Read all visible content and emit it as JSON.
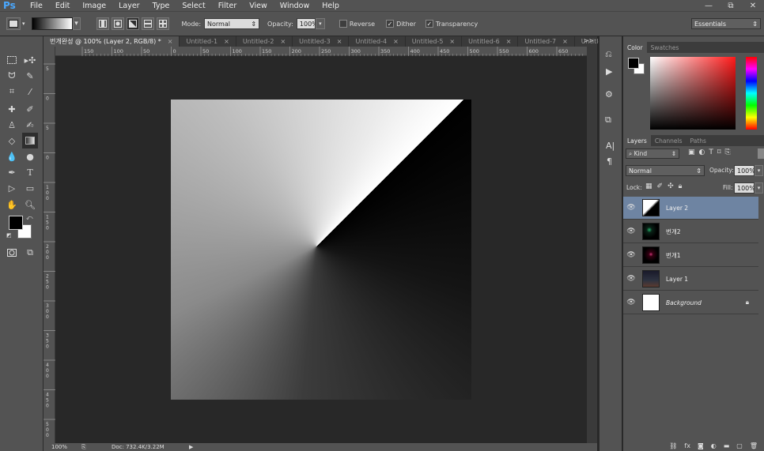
{
  "app": {
    "logo": "Ps"
  },
  "menu": [
    "File",
    "Edit",
    "Image",
    "Layer",
    "Type",
    "Select",
    "Filter",
    "View",
    "Window",
    "Help"
  ],
  "window_controls": [
    "—",
    "⧉",
    "✕"
  ],
  "options": {
    "mode_label": "Mode:",
    "mode_value": "Normal",
    "opacity_label": "Opacity:",
    "opacity_value": "100%",
    "reverse_label": "Reverse",
    "dither_label": "Dither",
    "transparency_label": "Transparency",
    "workspace": "Essentials"
  },
  "tabs": [
    {
      "label": "번개완성 @ 100% (Layer 2, RGB/8) *",
      "close": "×"
    },
    {
      "label": "Untitled-1",
      "close": "×"
    },
    {
      "label": "Untitled-2",
      "close": "×"
    },
    {
      "label": "Untitled-3",
      "close": "×"
    },
    {
      "label": "Untitled-4",
      "close": "×"
    },
    {
      "label": "Untitled-5",
      "close": "×"
    },
    {
      "label": "Untitled-6",
      "close": "×"
    },
    {
      "label": "Untitled-7",
      "close": "×"
    },
    {
      "label": "Untitle",
      "close": ""
    }
  ],
  "tab_overflow": ">>",
  "ruler_h_labels": [
    "150",
    "100",
    "50",
    "0",
    "50",
    "100",
    "150",
    "200",
    "250",
    "300",
    "350",
    "400",
    "450",
    "500",
    "550",
    "600",
    "650"
  ],
  "ruler_v_labels": [
    "5",
    "0",
    "5",
    "0",
    "1 0 0",
    "1 5 0",
    "2 0 0",
    "2 5 0",
    "3 0 0",
    "3 5 0",
    "4 0 0",
    "4 5 0",
    "5 0 0",
    "5 5 0"
  ],
  "status": {
    "zoom": "100%",
    "doc": "Doc: 732.4K/3.22M",
    "arrow": "▶"
  },
  "color_panel": {
    "tabs": [
      "Color",
      "Swatches"
    ]
  },
  "layers_panel": {
    "tabs": [
      "Layers",
      "Channels",
      "Paths"
    ],
    "kind_label": "Kind",
    "blend_mode": "Normal",
    "opacity_label": "Opacity:",
    "opacity_value": "100%",
    "lock_label": "Lock:",
    "fill_label": "Fill:",
    "fill_value": "100%",
    "layers": [
      {
        "name": "Layer 2",
        "selected": true
      },
      {
        "name": "번개2",
        "selected": false
      },
      {
        "name": "번개1",
        "selected": false
      },
      {
        "name": "Layer 1",
        "selected": false
      },
      {
        "name": "Background",
        "selected": false
      }
    ],
    "footer_icons": [
      "link-icon",
      "fx-icon",
      "mask-icon",
      "adjustment-icon",
      "group-icon",
      "new-layer-icon",
      "trash-icon"
    ]
  }
}
